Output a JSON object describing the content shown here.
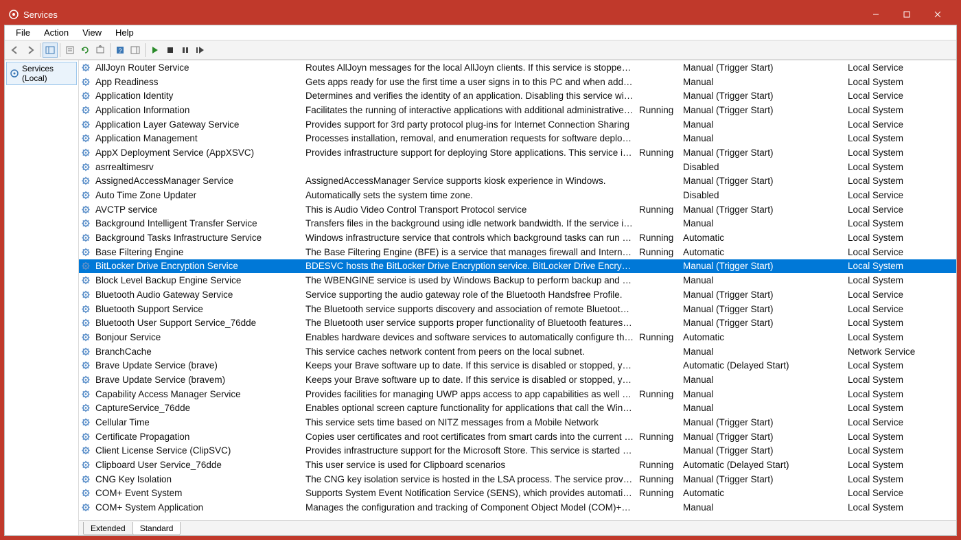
{
  "window": {
    "title": "Services"
  },
  "menu": {
    "file": "File",
    "action": "Action",
    "view": "View",
    "help": "Help"
  },
  "tree": {
    "root": "Services (Local)"
  },
  "tabs": {
    "extended": "Extended",
    "standard": "Standard"
  },
  "services": [
    {
      "name": "AllJoyn Router Service",
      "description": "Routes AllJoyn messages for the local AllJoyn clients. If this service is stopped the ...",
      "status": "",
      "startup": "Manual (Trigger Start)",
      "logon": "Local Service"
    },
    {
      "name": "App Readiness",
      "description": "Gets apps ready for use the first time a user signs in to this PC and when adding n...",
      "status": "",
      "startup": "Manual",
      "logon": "Local System"
    },
    {
      "name": "Application Identity",
      "description": "Determines and verifies the identity of an application. Disabling this service will pr...",
      "status": "",
      "startup": "Manual (Trigger Start)",
      "logon": "Local Service"
    },
    {
      "name": "Application Information",
      "description": "Facilitates the running of interactive applications with additional administrative pr...",
      "status": "Running",
      "startup": "Manual (Trigger Start)",
      "logon": "Local System"
    },
    {
      "name": "Application Layer Gateway Service",
      "description": "Provides support for 3rd party protocol plug-ins for Internet Connection Sharing",
      "status": "",
      "startup": "Manual",
      "logon": "Local Service"
    },
    {
      "name": "Application Management",
      "description": "Processes installation, removal, and enumeration requests for software deployed t...",
      "status": "",
      "startup": "Manual",
      "logon": "Local System"
    },
    {
      "name": "AppX Deployment Service (AppXSVC)",
      "description": "Provides infrastructure support for deploying Store applications. This service is sta...",
      "status": "Running",
      "startup": "Manual (Trigger Start)",
      "logon": "Local System"
    },
    {
      "name": "asrrealtimesrv",
      "description": "",
      "status": "",
      "startup": "Disabled",
      "logon": "Local System"
    },
    {
      "name": "AssignedAccessManager Service",
      "description": "AssignedAccessManager Service supports kiosk experience in Windows.",
      "status": "",
      "startup": "Manual (Trigger Start)",
      "logon": "Local System"
    },
    {
      "name": "Auto Time Zone Updater",
      "description": "Automatically sets the system time zone.",
      "status": "",
      "startup": "Disabled",
      "logon": "Local Service"
    },
    {
      "name": "AVCTP service",
      "description": "This is Audio Video Control Transport Protocol service",
      "status": "Running",
      "startup": "Manual (Trigger Start)",
      "logon": "Local Service"
    },
    {
      "name": "Background Intelligent Transfer Service",
      "description": "Transfers files in the background using idle network bandwidth. If the service is dis...",
      "status": "",
      "startup": "Manual",
      "logon": "Local System"
    },
    {
      "name": "Background Tasks Infrastructure Service",
      "description": "Windows infrastructure service that controls which background tasks can run on t...",
      "status": "Running",
      "startup": "Automatic",
      "logon": "Local System"
    },
    {
      "name": "Base Filtering Engine",
      "description": "The Base Filtering Engine (BFE) is a service that manages firewall and Internet Prot...",
      "status": "Running",
      "startup": "Automatic",
      "logon": "Local Service"
    },
    {
      "name": "BitLocker Drive Encryption Service",
      "description": "BDESVC hosts the BitLocker Drive Encryption service. BitLocker Drive Encryption pr...",
      "status": "",
      "startup": "Manual (Trigger Start)",
      "logon": "Local System",
      "selected": true
    },
    {
      "name": "Block Level Backup Engine Service",
      "description": "The WBENGINE service is used by Windows Backup to perform backup and recove...",
      "status": "",
      "startup": "Manual",
      "logon": "Local System"
    },
    {
      "name": "Bluetooth Audio Gateway Service",
      "description": "Service supporting the audio gateway role of the Bluetooth Handsfree Profile.",
      "status": "",
      "startup": "Manual (Trigger Start)",
      "logon": "Local Service"
    },
    {
      "name": "Bluetooth Support Service",
      "description": "The Bluetooth service supports discovery and association of remote Bluetooth de...",
      "status": "",
      "startup": "Manual (Trigger Start)",
      "logon": "Local Service"
    },
    {
      "name": "Bluetooth User Support Service_76dde",
      "description": "The Bluetooth user service supports proper functionality of Bluetooth features rel...",
      "status": "",
      "startup": "Manual (Trigger Start)",
      "logon": "Local System"
    },
    {
      "name": "Bonjour Service",
      "description": "Enables hardware devices and software services to automatically configure themse...",
      "status": "Running",
      "startup": "Automatic",
      "logon": "Local System"
    },
    {
      "name": "BranchCache",
      "description": "This service caches network content from peers on the local subnet.",
      "status": "",
      "startup": "Manual",
      "logon": "Network Service"
    },
    {
      "name": "Brave Update Service (brave)",
      "description": "Keeps your Brave software up to date. If this service is disabled or stopped, your B...",
      "status": "",
      "startup": "Automatic (Delayed Start)",
      "logon": "Local System"
    },
    {
      "name": "Brave Update Service (bravem)",
      "description": "Keeps your Brave software up to date. If this service is disabled or stopped, your B...",
      "status": "",
      "startup": "Manual",
      "logon": "Local System"
    },
    {
      "name": "Capability Access Manager Service",
      "description": "Provides facilities for managing UWP apps access to app capabilities as well as che...",
      "status": "Running",
      "startup": "Manual",
      "logon": "Local System"
    },
    {
      "name": "CaptureService_76dde",
      "description": "Enables optional screen capture functionality for applications that call the Windo...",
      "status": "",
      "startup": "Manual",
      "logon": "Local System"
    },
    {
      "name": "Cellular Time",
      "description": "This service sets time based on NITZ messages from a Mobile Network",
      "status": "",
      "startup": "Manual (Trigger Start)",
      "logon": "Local Service"
    },
    {
      "name": "Certificate Propagation",
      "description": "Copies user certificates and root certificates from smart cards into the current user'...",
      "status": "Running",
      "startup": "Manual (Trigger Start)",
      "logon": "Local System"
    },
    {
      "name": "Client License Service (ClipSVC)",
      "description": "Provides infrastructure support for the Microsoft Store. This service is started on d...",
      "status": "",
      "startup": "Manual (Trigger Start)",
      "logon": "Local System"
    },
    {
      "name": "Clipboard User Service_76dde",
      "description": "This user service is used for Clipboard scenarios",
      "status": "Running",
      "startup": "Automatic (Delayed Start)",
      "logon": "Local System"
    },
    {
      "name": "CNG Key Isolation",
      "description": "The CNG key isolation service is hosted in the LSA process. The service provides ke...",
      "status": "Running",
      "startup": "Manual (Trigger Start)",
      "logon": "Local System"
    },
    {
      "name": "COM+ Event System",
      "description": "Supports System Event Notification Service (SENS), which provides automatic distri...",
      "status": "Running",
      "startup": "Automatic",
      "logon": "Local Service"
    },
    {
      "name": "COM+ System Application",
      "description": "Manages the configuration and tracking of Component Object Model (COM)+-ba...",
      "status": "",
      "startup": "Manual",
      "logon": "Local System"
    }
  ]
}
